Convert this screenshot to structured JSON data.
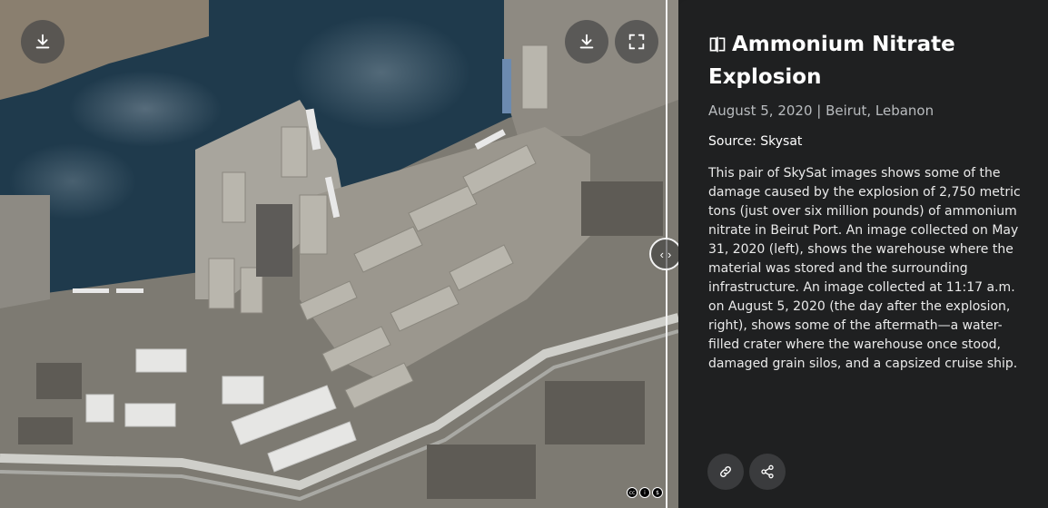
{
  "image": {
    "download_left_label": "Download before image",
    "download_right_label": "Download after image",
    "fullscreen_label": "Full screen",
    "license_icons": [
      "cc",
      "by",
      "nc"
    ]
  },
  "panel": {
    "title": "Ammonium Nitrate Explosion",
    "date_location": "August 5, 2020 | Beirut, Lebanon",
    "source": "Source: Skysat",
    "description": "This pair of SkySat images shows some of the damage caused by the explosion of 2,750 metric tons (just over six million pounds) of ammonium nitrate in Beirut Port. An image collected on May 31, 2020 (left), shows the warehouse where the material was stored and the surrounding infrastructure. An image collected at 11:17 a.m. on August 5, 2020 (the day after the explosion, right), shows some of the aftermath—a water-filled crater where the warehouse once stood, damaged grain silos, and a capsized cruise ship."
  },
  "colors": {
    "panel_bg": "#1f2021",
    "water": "#1f3a4c",
    "text_muted": "#b9bcbf"
  }
}
